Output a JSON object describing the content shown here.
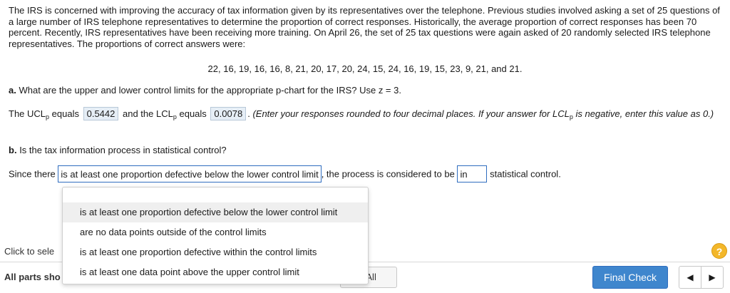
{
  "problem": {
    "text": "The IRS is concerned with improving the accuracy of tax information given by its representatives over the telephone. Previous studies involved asking a set of 25 questions of a large number of IRS telephone representatives to determine the proportion of correct responses. Historically, the average proportion of correct responses has been 70 percent. Recently, IRS representatives have been receiving more training. On April 26, the set of 25 tax questions were again asked of 20 randomly selected IRS telephone representatives. The proportions of correct answers were:",
    "values": "22, 16, 19, 16, 16, 8, 21, 20, 17, 20, 24, 15, 24, 16, 19, 15, 23, 9, 21, and 21."
  },
  "part_a": {
    "label": "a.",
    "question": "What are the upper and lower control limits for the appropriate p-chart for the IRS? Use z = 3."
  },
  "ucl_line": {
    "prefix": "The UCL",
    "sub_p": "p",
    "equals1": "equals",
    "ucl_value": "0.5442",
    "and_the": "and the LCL",
    "equals2": "equals",
    "lcl_value": "0.0078",
    "period": ".",
    "instruction_part1": "(Enter your responses rounded to four decimal places. If your answer for LCL",
    "instruction_part2": "is negative, enter this value as 0.)"
  },
  "part_b": {
    "label": "b.",
    "question": "Is the tax information process in statistical control?"
  },
  "since_line": {
    "prefix": "Since there",
    "selected": "is at least one proportion defective below the lower control limit",
    "middle": ", the process is considered to be",
    "in_value": "in",
    "suffix": "statistical control."
  },
  "dropdown": {
    "options": [
      "is at least one proportion defective below the lower control limit",
      "are no data points outside of the control limits",
      "is at least one proportion defective within the control limits",
      "is at least one data point above the upper control limit"
    ]
  },
  "footer": {
    "click_to_select": "Click to sele",
    "all_parts": "All parts sho",
    "clear_all": "r All",
    "help": "?",
    "final_check": "Final Check",
    "prev": "◀",
    "next": "▶"
  }
}
